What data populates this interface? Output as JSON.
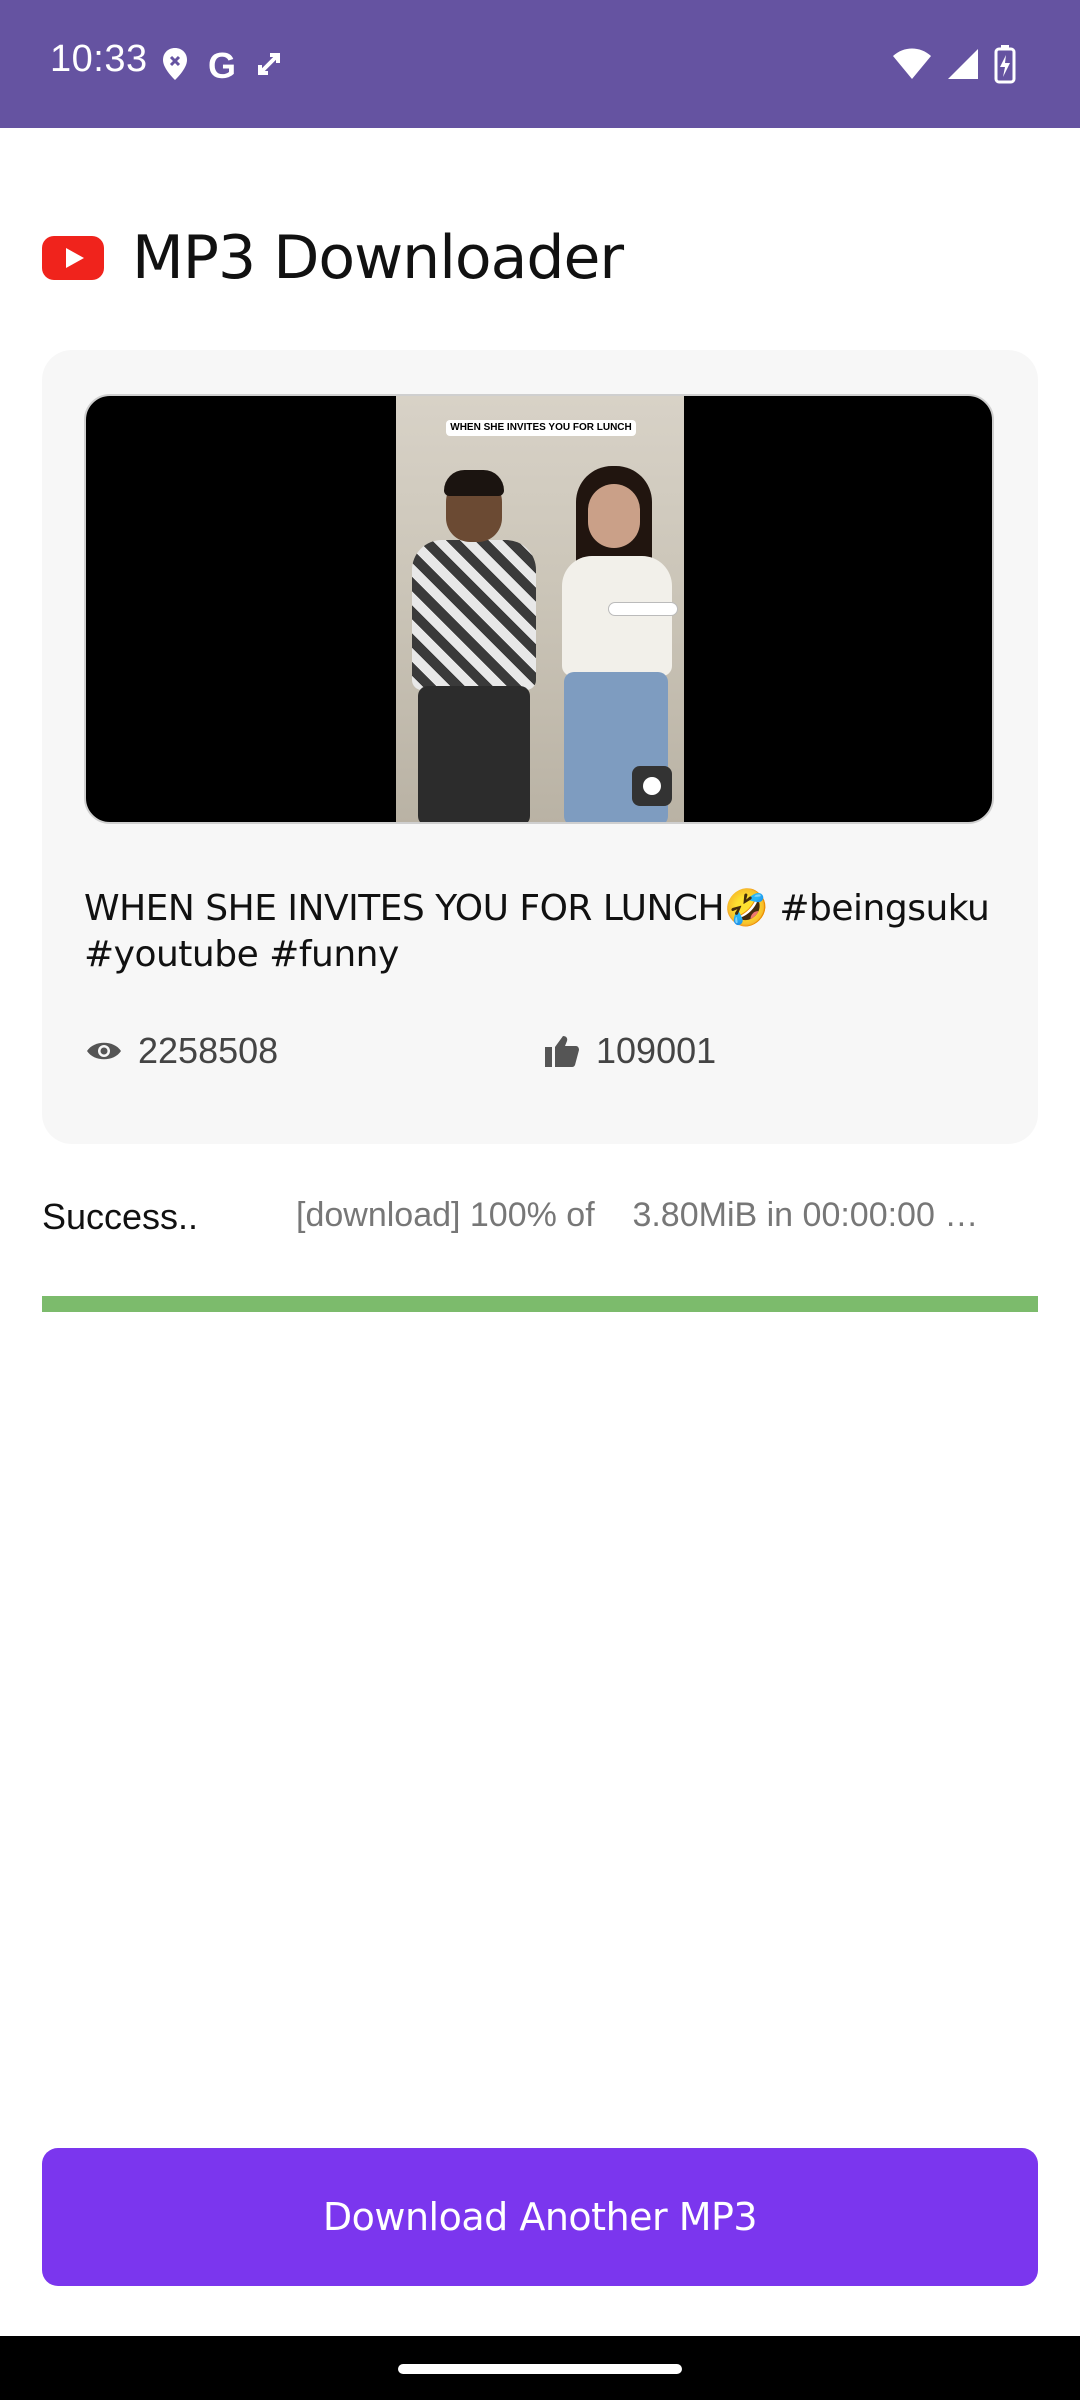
{
  "status_bar": {
    "time": "10:33",
    "left_icons": [
      "location-icon",
      "google-icon",
      "sync-icon"
    ],
    "right_icons": [
      "wifi-icon",
      "signal-icon",
      "battery-charging-icon"
    ],
    "google_glyph": "G"
  },
  "header": {
    "title": "MP3 Downloader",
    "logo_icon": "youtube-logo"
  },
  "video": {
    "thumbnail_caption": "WHEN SHE INVITES YOU FOR LUNCH",
    "title": "WHEN SHE INVITES YOU FOR LUNCH🤣 #beingsuku #youtube #funny",
    "views": "2258508",
    "likes": "109001",
    "views_icon": "eye-icon",
    "likes_icon": "thumbs-up-icon"
  },
  "progress": {
    "status": "Success..",
    "log": "[download] 100% of    3.80MiB in 00:00:00 …",
    "percent": 100,
    "color": "#7cbb6c"
  },
  "actions": {
    "download_another_label": "Download Another MP3"
  },
  "colors": {
    "status_bar": "#6553a1",
    "accent": "#7b36ee",
    "youtube_red": "#f0231c"
  }
}
